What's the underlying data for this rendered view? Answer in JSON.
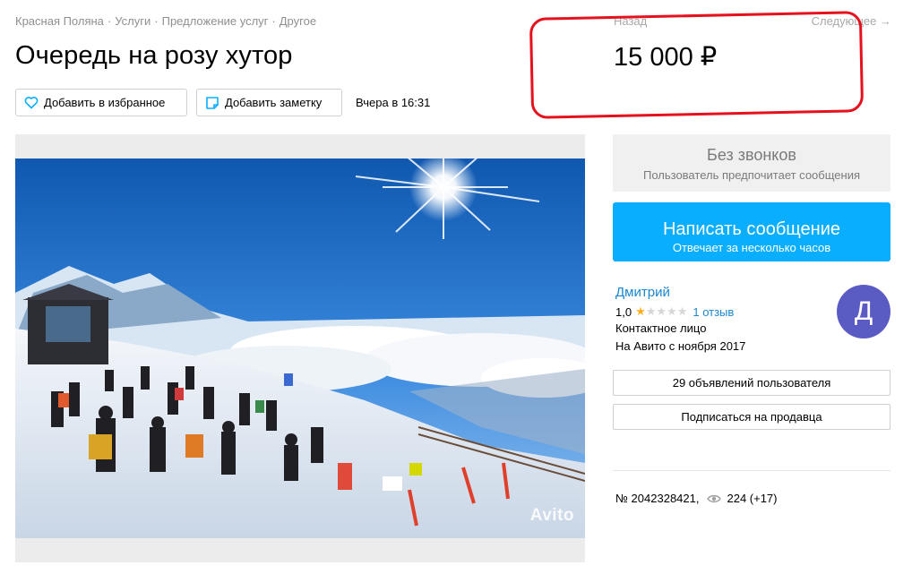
{
  "breadcrumbs": [
    "Красная Поляна",
    "Услуги",
    "Предложение услуг",
    "Другое"
  ],
  "breadcrumb_separator": "·",
  "title": "Очередь на розу хутор",
  "nav": {
    "back": "Назад",
    "next": "Следующее →"
  },
  "price": "15 000 ₽",
  "actions": {
    "favorite_label": "Добавить в избранное",
    "note_label": "Добавить заметку",
    "date": "Вчера в 16:31"
  },
  "photo": {
    "watermark": "Avito"
  },
  "contact_panel": {
    "no_calls_title": "Без звонков",
    "no_calls_subtitle": "Пользователь предпочитает сообщения",
    "message_button": "Написать сообщение",
    "message_subtitle": "Отвечает за несколько часов"
  },
  "seller": {
    "name": "Дмитрий",
    "rating": "1,0",
    "rating_stars": 1,
    "reviews": "1 отзыв",
    "role": "Контактное лицо",
    "since": "На Авито с ноября 2017",
    "avatar_letter": "Д",
    "avatar_color": "#5b5bc4",
    "ads_button": "29 объявлений пользователя",
    "subscribe_button": "Подписаться на продавца"
  },
  "listing_meta": {
    "number": "№ 2042328421,",
    "views": "224 (+17)"
  },
  "colors": {
    "accent": "#0aaeff",
    "link": "#1b87ce",
    "highlight": "#e5111d",
    "star": "#ffb021"
  },
  "icons": {
    "favorite": "heart-icon",
    "note": "note-icon",
    "views": "eye-icon"
  }
}
